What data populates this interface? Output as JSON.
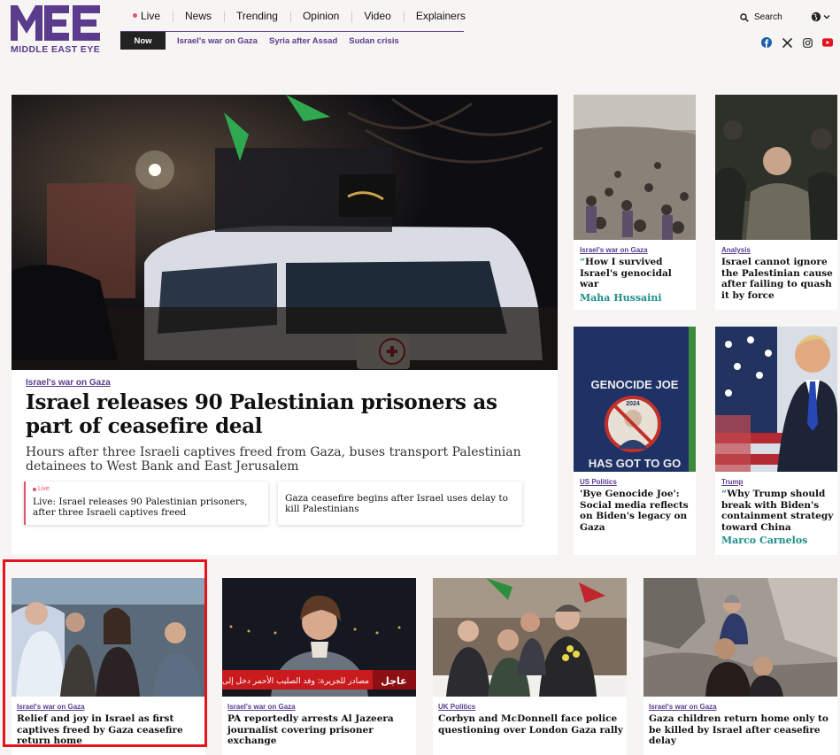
{
  "brand": {
    "name": "MIDDLE EAST EYE",
    "accent": "#5b3b8c",
    "teal": "#1d8f8a",
    "live": "#e5526a"
  },
  "nav": {
    "items": [
      "Live",
      "News",
      "Trending",
      "Opinion",
      "Video",
      "Explainers"
    ],
    "search_label": "Search"
  },
  "subnav": {
    "now_label": "Now",
    "links": [
      "Israel's war on Gaza",
      "Syria after Assad",
      "Sudan crisis"
    ]
  },
  "social_icons": [
    "facebook-icon",
    "x-icon",
    "instagram-icon",
    "youtube-icon"
  ],
  "hero": {
    "tag": "Israel's war on Gaza",
    "title": "Israel releases 90 Palestinian prisoners as part of ceasefire deal",
    "subtitle": "Hours after three Israeli captives freed from Gaza, buses transport Palestinian detainees to West Bank and East Jerusalem",
    "related": [
      {
        "live_label": "Live",
        "title": "Live: Israel releases 90 Palestinian prisoners, after three Israeli captives freed"
      },
      {
        "title": "Gaza ceasefire begins after Israel uses delay to kill Palestinians"
      }
    ]
  },
  "side_cards": [
    {
      "tag": "Israel's war on Gaza",
      "quote_mark": "“",
      "title": "How I survived Israel's genocidal war",
      "author": "Maha Hussaini"
    },
    {
      "tag": "Analysis",
      "title": "Israel cannot ignore the Palestinian cause after failing to quash it by force"
    },
    {
      "tag": "US Politics",
      "title": "'Bye Genocide Joe': Social media reflects on Biden's legacy on Gaza",
      "shirt_text_top": "GENOCIDE JOE",
      "shirt_text_bottom": "HAS GOT TO GO",
      "shirt_badge": "2024"
    },
    {
      "tag": "Trump",
      "quote_mark": "“",
      "title": "Why Trump should break with Biden's containment strategy toward China",
      "author": "Marco Carnelos"
    }
  ],
  "bottom_cards": [
    {
      "tag": "Israel's war on Gaza",
      "title": "Relief and joy in Israel as first captives freed by Gaza ceasefire return home"
    },
    {
      "tag": "Israel's war on Gaza",
      "title": "PA reportedly arrests Al Jazeera journalist covering prisoner exchange",
      "ticker_badge": "عاجل",
      "ticker_text": "مصادر للجزيرة: وفد الصليب الأحمر دخل إلى"
    },
    {
      "tag": "UK Politics",
      "title": "Corbyn and McDonnell face police questioning over London Gaza rally"
    },
    {
      "tag": "Israel's war on Gaza",
      "title": "Gaza children return home only to be killed by Israel after ceasefire delay"
    }
  ]
}
